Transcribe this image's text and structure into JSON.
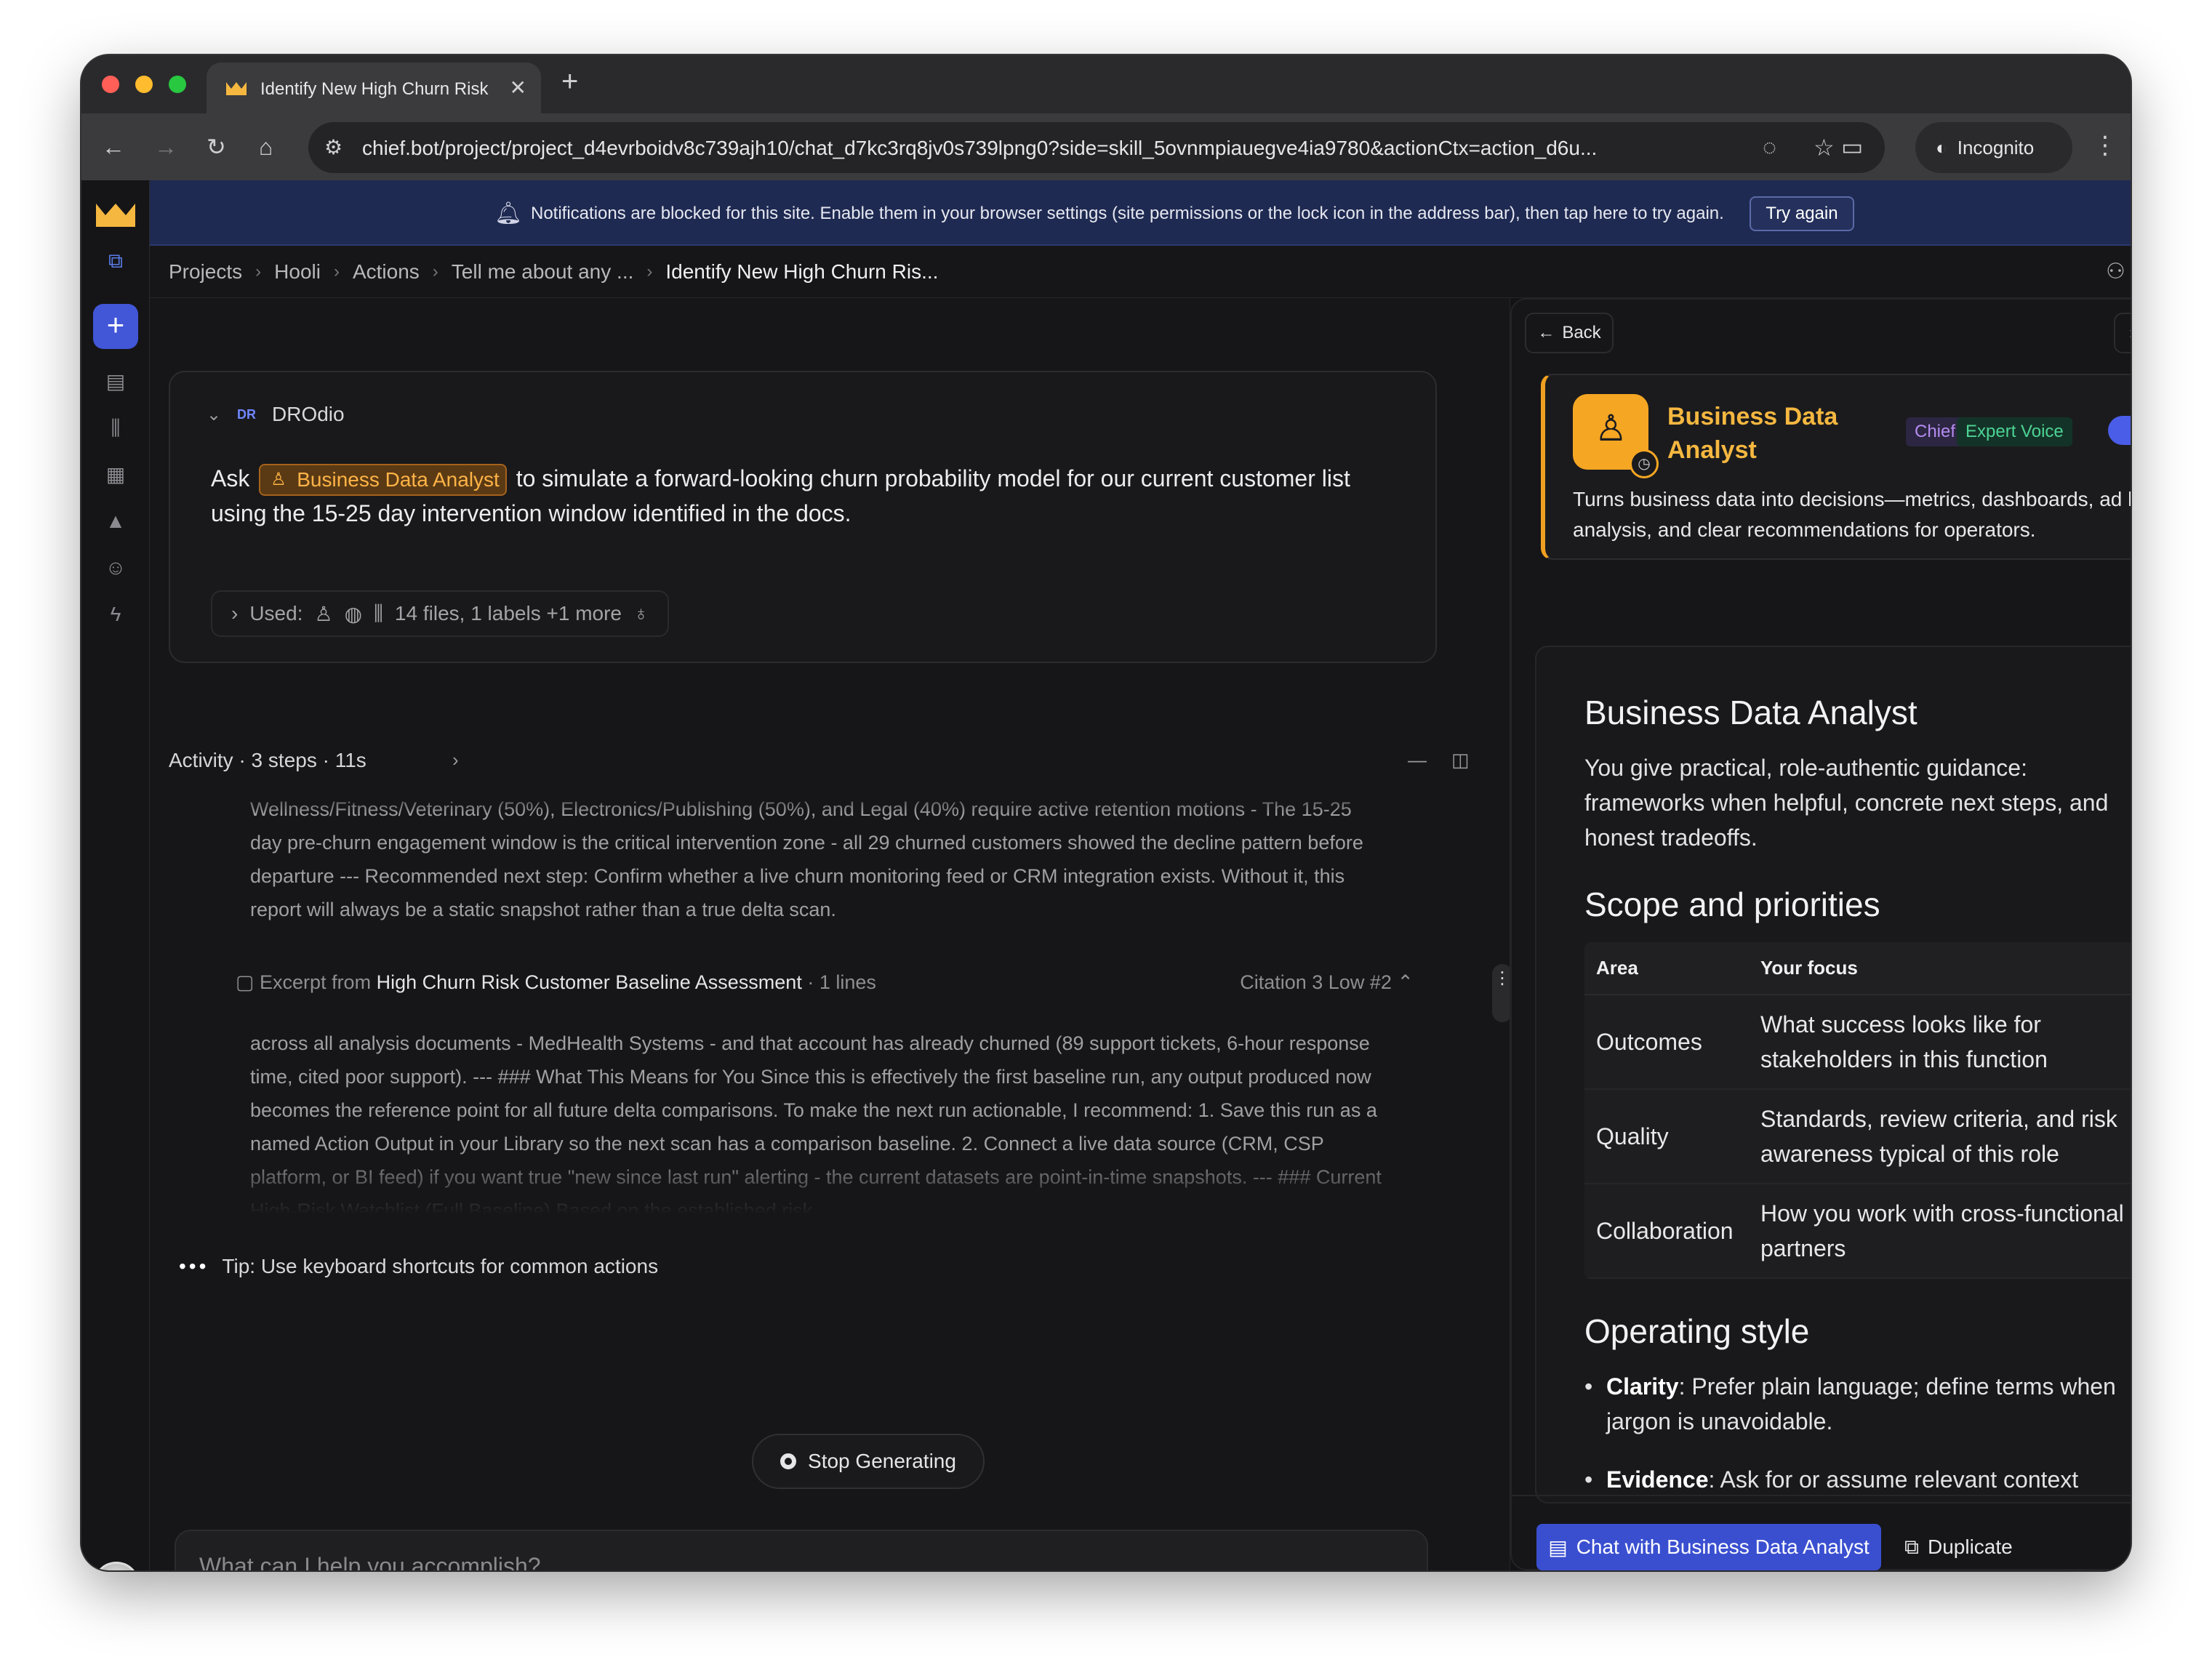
{
  "browser": {
    "tab_title": "Identify New High Churn Risk",
    "url": "chief.bot/project/project_d4evrboidv8c739ajh10/chat_d7kc3rq8jv0s739lpng0?side=skill_5ovnmpiauegve4ia9780&actionCtx=action_d6u...",
    "incognito_label": "Incognito"
  },
  "banner": {
    "text": "Notifications are blocked for this site. Enable them in your browser settings (site permissions or the lock icon in the address bar), then tap here to try again.",
    "button": "Try again"
  },
  "breadcrumb": [
    "Projects",
    "Hooli",
    "Actions",
    "Tell me about any ...",
    "Identify New High Churn Ris..."
  ],
  "prompt": {
    "user_initials": "DR",
    "user_name": "DROdio",
    "text_before": "Ask",
    "skill_chip": "Business Data Analyst",
    "text_after": "to simulate a forward-looking churn probability model for our current customer list using the 15-25 day intervention window identified in the docs.",
    "used_label": "Used:",
    "used_summary": "14 files, 1 labels +1 more"
  },
  "activity": {
    "header": "Activity · 3 steps · 11s",
    "para1": "Wellness/Fitness/Veterinary (50%), Electronics/Publishing (50%), and Legal (40%) require active retention motions - The 15-25 day pre-churn engagement window is the critical intervention zone - all 29 churned customers showed the decline pattern before departure --- Recommended next step: Confirm whether a live churn monitoring feed or CRM integration exists. Without it, this report will always be a static snapshot rather than a true delta scan.",
    "excerpt_prefix": "Excerpt from",
    "excerpt_doc": "High Churn Risk Customer Baseline Assessment",
    "excerpt_lines": "· 1 lines",
    "excerpt_meta": "Citation 3   Low   #2",
    "para2": "across all analysis documents - MedHealth Systems - and that account has already churned (89 support tickets, 6-hour response time, cited poor support). --- ### What This Means for You Since this is effectively the first baseline run, any output produced now becomes the reference point for all future delta comparisons. To make the next run actionable, I recommend: 1. Save this run as a named Action Output in your Library so the next scan has a comparison baseline. 2. Connect a live data source (CRM, CSP platform, or BI feed) if you want true \"new since last run\" alerting - the current datasets are point-in-time snapshots. --- ### Current High-Risk Watchlist (Full Baseline) Based on the established risk"
  },
  "tip": "Tip: Use keyboard shortcuts for common actions",
  "stop_button": "Stop Generating",
  "composer": {
    "placeholder": "What can I help you accomplish?"
  },
  "panel": {
    "back": "Back",
    "skill_name": "Business Data Analyst",
    "tag_chief": "Chief",
    "tag_expert": "Expert Voice",
    "toggle_on": true,
    "description": "Turns business data into decisions—metrics, dashboards, ad hoc analysis, and clear recommendations for operators.",
    "doc": {
      "title": "Business Data Analyst",
      "intro": "You give practical, role-authentic guidance: frameworks when helpful, concrete next steps, and honest tradeoffs.",
      "scope_heading": "Scope and priorities",
      "table_headers": [
        "Area",
        "Your focus"
      ],
      "table_rows": [
        [
          "Outcomes",
          "What success looks like for stakeholders in this function"
        ],
        [
          "Quality",
          "Standards, review criteria, and risk awareness typical of this role"
        ],
        [
          "Collaboration",
          "How you work with cross-functional partners"
        ]
      ],
      "style_heading": "Operating style",
      "bullets": [
        {
          "term": "Clarity",
          "text": ": Prefer plain language; define terms when jargon is unavoidable."
        },
        {
          "term": "Evidence",
          "text": ": Ask for or assume relevant context"
        }
      ]
    },
    "chat_button": "Chat with Business Data Analyst",
    "duplicate_button": "Duplicate"
  },
  "colors": {
    "accent": "#4256d8",
    "skill_orange": "#f5a623",
    "banner_bg": "#1f2a52"
  }
}
